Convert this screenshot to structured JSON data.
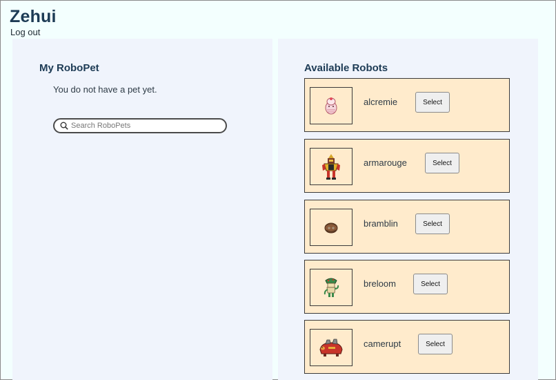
{
  "header": {
    "username": "Zehui",
    "logout_label": "Log out"
  },
  "my_robopet": {
    "title": "My RoboPet",
    "status_text": "You do not have a pet yet.",
    "search": {
      "placeholder": "Search RoboPets",
      "value": ""
    }
  },
  "available": {
    "title": "Available Robots",
    "robots": [
      {
        "name": "alcremie",
        "select_label": "Select",
        "icon": "alcremie-sprite"
      },
      {
        "name": "armarouge",
        "select_label": "Select",
        "icon": "armarouge-sprite"
      },
      {
        "name": "bramblin",
        "select_label": "Select",
        "icon": "bramblin-sprite"
      },
      {
        "name": "breloom",
        "select_label": "Select",
        "icon": "breloom-sprite"
      },
      {
        "name": "camerupt",
        "select_label": "Select",
        "icon": "camerupt-sprite"
      }
    ]
  },
  "colors": {
    "page_bg": "#f3fffe",
    "panel_bg": "#f0f4fc",
    "card_bg": "#ffebcc",
    "heading": "#1d3b55"
  }
}
